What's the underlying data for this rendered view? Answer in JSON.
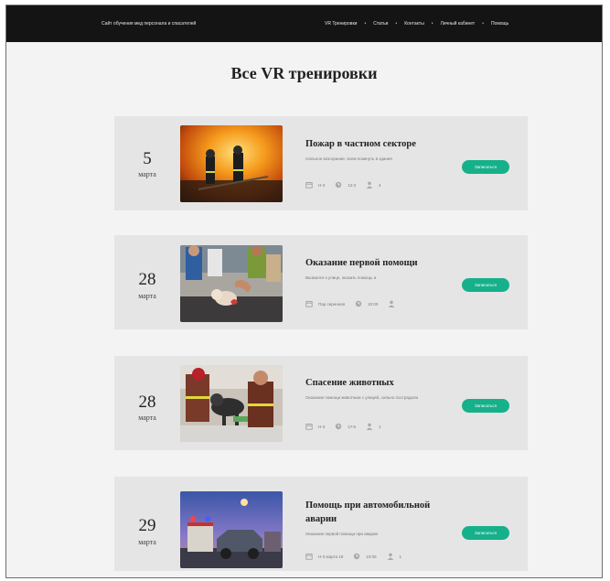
{
  "header": {
    "site_title": "Сайт обучения мед персонала и спасателей",
    "nav": [
      "VR Тренировки",
      "Статьи",
      "Контакты",
      "Личный кабинет",
      "Помощь"
    ]
  },
  "page_title": "Все VR тренировки",
  "colors": {
    "accent": "#16b08a",
    "topbar": "#141414",
    "card": "#e5e5e5"
  },
  "cards": [
    {
      "day": "5",
      "month": "марта",
      "title": "Пожар в частном секторе",
      "desc": "Сильное возгорание, всем покинуть в здания",
      "meta": [
        "Н-3",
        "12:3",
        "4"
      ],
      "button": "Записаться",
      "photo": "firefighters-photo"
    },
    {
      "day": "28",
      "month": "марта",
      "title": "Оказание первой помощи",
      "desc": "Вызвался к улице, оказать помощь и",
      "meta": [
        "Пар серенная",
        "10:00",
        ""
      ],
      "button": "Записаться",
      "photo": "first-aid-photo"
    },
    {
      "day": "28",
      "month": "марта",
      "title": "Спасение животных",
      "desc": "Оказание помощи животным с улицей, сильно пострадали",
      "meta": [
        "Н-3",
        "17:6",
        "1"
      ],
      "button": "Записаться",
      "photo": "animal-rescue-photo"
    },
    {
      "day": "29",
      "month": "марта",
      "title": "Помощь при автомобильной аварии",
      "desc": "Оказание первой помощи при аварии",
      "meta": [
        "Н-3 марта 18",
        "10:00",
        "1"
      ],
      "button": "Записаться",
      "photo": "car-crash-photo"
    }
  ]
}
